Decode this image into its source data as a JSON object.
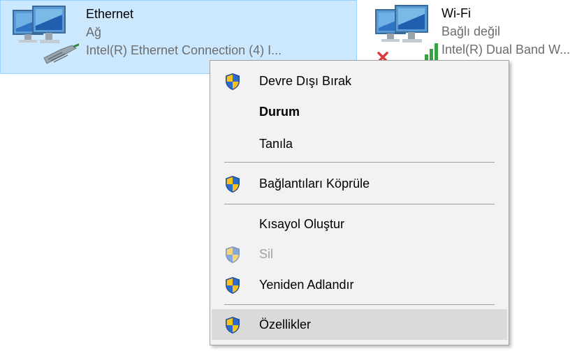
{
  "adapters": {
    "ethernet": {
      "name": "Ethernet",
      "status": "Ağ",
      "device": "Intel(R) Ethernet Connection (4) I..."
    },
    "wifi": {
      "name": "Wi-Fi",
      "status": "Bağlı değil",
      "device": "Intel(R) Dual Band W..."
    }
  },
  "context_menu": {
    "items": [
      {
        "label": "Devre Dışı Bırak",
        "icon": "uac-shield-icon"
      },
      {
        "label": "Durum"
      },
      {
        "label": "Tanıla"
      },
      {
        "label": "Bağlantıları Köprüle",
        "icon": "uac-shield-icon"
      },
      {
        "label": "Kısayol Oluştur"
      },
      {
        "label": "Sil",
        "icon": "uac-shield-icon",
        "disabled": true
      },
      {
        "label": "Yeniden Adlandır",
        "icon": "uac-shield-icon"
      },
      {
        "label": "Özellikler",
        "icon": "uac-shield-icon",
        "highlighted": true
      }
    ]
  },
  "colors": {
    "selection_bg": "#cce8ff",
    "menu_bg": "#f2f2f2",
    "menu_highlight": "#dadada",
    "disabled_text": "#a0a0a0"
  }
}
